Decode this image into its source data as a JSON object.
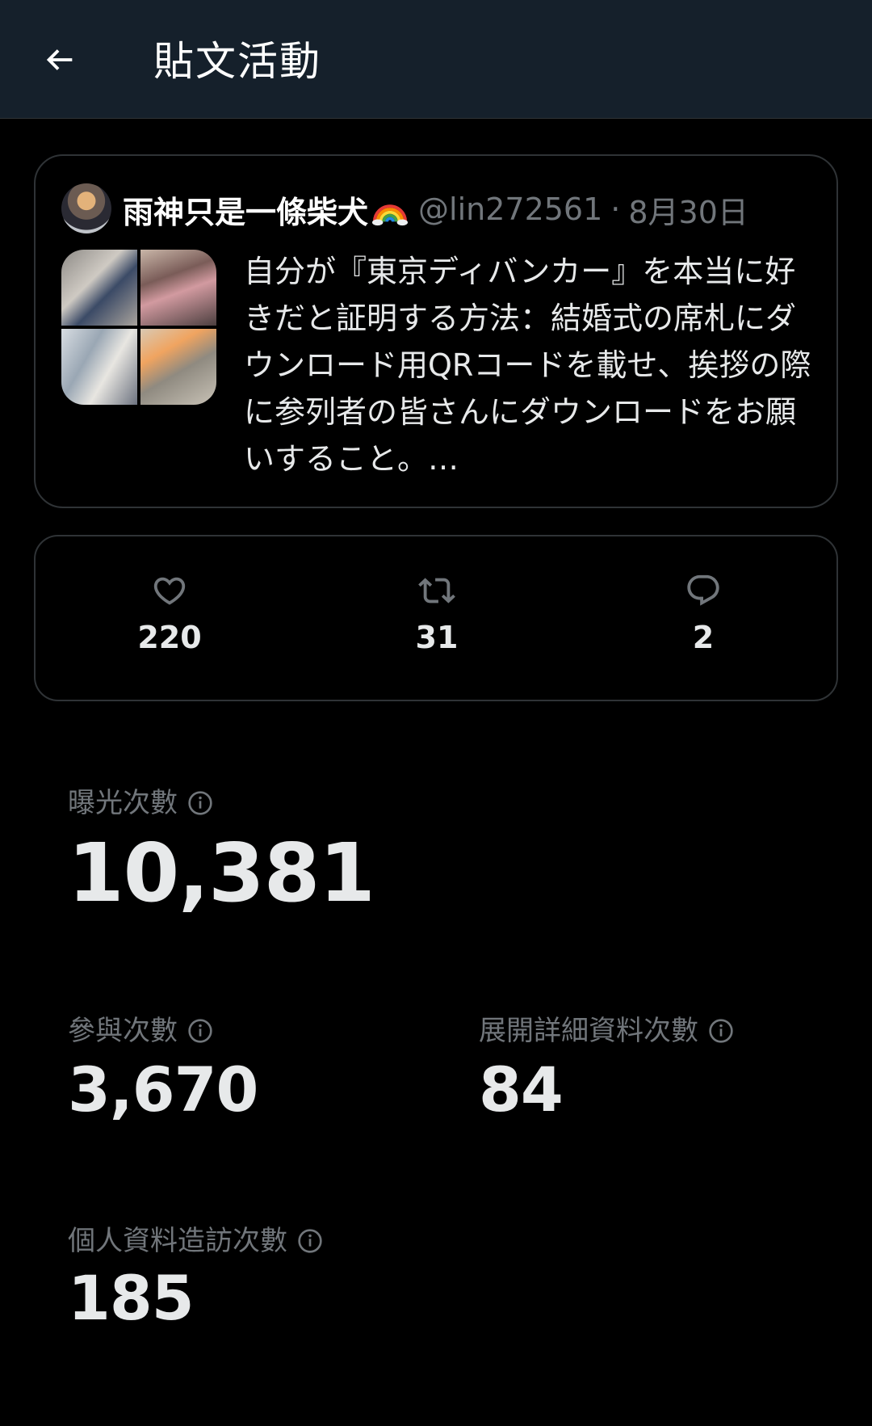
{
  "header": {
    "title": "貼文活動",
    "back_icon": "arrow-left-icon"
  },
  "tweet": {
    "display_name": "雨神只是一條柴犬",
    "name_emoji": "rainbow-emoji-icon",
    "handle": "@lin272561",
    "separator": "·",
    "date": "8月30日",
    "text": "自分が『東京ディバンカー』を本当に好きだと証明する方法：結婚式の席札にダウンロード用QRコードを載せ、挨拶の際に参列者の皆さんにダウンロードをお願いすること。…"
  },
  "engagement": {
    "likes": "220",
    "retweets": "31",
    "replies": "2",
    "like_icon": "heart-icon",
    "retweet_icon": "retweet-icon",
    "reply_icon": "reply-bubble-icon"
  },
  "metrics": {
    "impressions_label": "曝光次數",
    "impressions_value": "10,381",
    "engagements_label": "參與次數",
    "engagements_value": "3,670",
    "detail_expands_label": "展開詳細資料次數",
    "detail_expands_value": "84",
    "profile_visits_label": "個人資料造訪次數",
    "profile_visits_value": "185",
    "info_icon": "info-circle-icon"
  },
  "colors": {
    "background": "#000000",
    "header_background": "#15202b",
    "border": "#2f3336",
    "primary_text": "#e7e9ea",
    "secondary_text": "#71767b"
  }
}
